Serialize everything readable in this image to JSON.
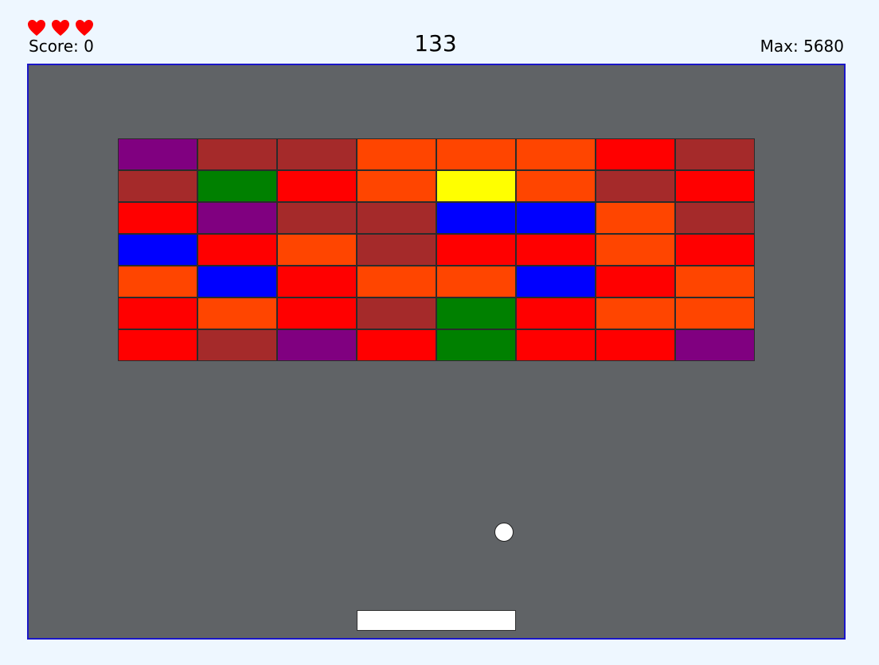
{
  "hud": {
    "lives": 3,
    "score_text": "Score: 0",
    "timer_text": "133",
    "max_text": "Max: 5680",
    "heart_color": "#ff0000"
  },
  "colors": {
    "P": "#800080",
    "B": "#a52a2a",
    "O": "#ff4500",
    "R": "#ff0000",
    "G": "#008000",
    "Y": "#ffff00",
    "U": "#0000ff"
  },
  "bricks": [
    [
      "P",
      "B",
      "B",
      "O",
      "O",
      "O",
      "R",
      "B"
    ],
    [
      "B",
      "G",
      "R",
      "O",
      "Y",
      "O",
      "B",
      "R"
    ],
    [
      "R",
      "P",
      "B",
      "B",
      "U",
      "U",
      "O",
      "B"
    ],
    [
      "U",
      "R",
      "O",
      "B",
      "R",
      "R",
      "O",
      "R"
    ],
    [
      "O",
      "U",
      "R",
      "O",
      "O",
      "U",
      "R",
      "O"
    ],
    [
      "R",
      "O",
      "R",
      "B",
      "G",
      "R",
      "O",
      "O"
    ],
    [
      "R",
      "B",
      "P",
      "R",
      "G",
      "R",
      "R",
      "P"
    ]
  ]
}
